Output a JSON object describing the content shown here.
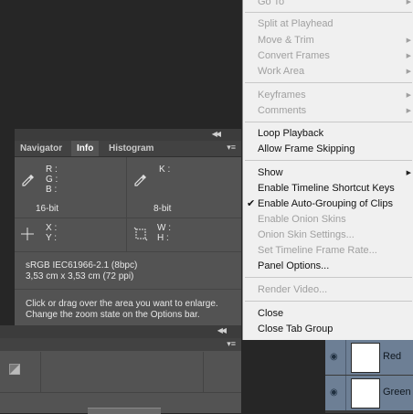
{
  "info_panel": {
    "tabs": [
      "Navigator",
      "Info",
      "Histogram"
    ],
    "active_tab": "Info",
    "rgb_letters": [
      "R :",
      "G :",
      "B :"
    ],
    "k_letter": "K :",
    "xy_letters": [
      "X :",
      "Y :"
    ],
    "wh_letters": [
      "W :",
      "H :"
    ],
    "bit_left": "16-bit",
    "bit_right": "8-bit",
    "profile": "sRGB IEC61966-2.1 (8bpc)",
    "doc_size": "3,53 cm x 3,53 cm (72 ppi)",
    "help_line1": "Click or drag over the area you want to enlarge.",
    "help_line2": "Change the zoom state on the Options bar."
  },
  "layers": [
    {
      "name": "Red"
    },
    {
      "name": "Green"
    }
  ],
  "context_menu": {
    "items": [
      {
        "label": "Go To",
        "disabled": true,
        "submenu": true
      },
      {
        "label": "Split at Playhead",
        "disabled": true,
        "submenu": false
      },
      {
        "label": "Move & Trim",
        "disabled": true,
        "submenu": true
      },
      {
        "label": "Convert Frames",
        "disabled": true,
        "submenu": true
      },
      {
        "label": "Work Area",
        "disabled": true,
        "submenu": true
      },
      {
        "label": "Keyframes",
        "disabled": true,
        "submenu": true
      },
      {
        "label": "Comments",
        "disabled": true,
        "submenu": true
      },
      {
        "label": "Loop Playback",
        "disabled": false,
        "submenu": false
      },
      {
        "label": "Allow Frame Skipping",
        "disabled": false,
        "submenu": false
      },
      {
        "label": "Show",
        "disabled": false,
        "submenu": true
      },
      {
        "label": "Enable Timeline Shortcut Keys",
        "disabled": false,
        "submenu": false
      },
      {
        "label": "Enable Auto-Grouping of Clips",
        "disabled": false,
        "submenu": false,
        "checked": true
      },
      {
        "label": "Enable Onion Skins",
        "disabled": true,
        "submenu": false
      },
      {
        "label": "Onion Skin Settings...",
        "disabled": true,
        "submenu": false
      },
      {
        "label": "Set Timeline Frame Rate...",
        "disabled": true,
        "submenu": false
      },
      {
        "label": "Panel Options...",
        "disabled": false,
        "submenu": false
      },
      {
        "label": "Render Video...",
        "disabled": true,
        "submenu": false
      },
      {
        "label": "Close",
        "disabled": false,
        "submenu": false
      },
      {
        "label": "Close Tab Group",
        "disabled": false,
        "submenu": false
      }
    ]
  }
}
